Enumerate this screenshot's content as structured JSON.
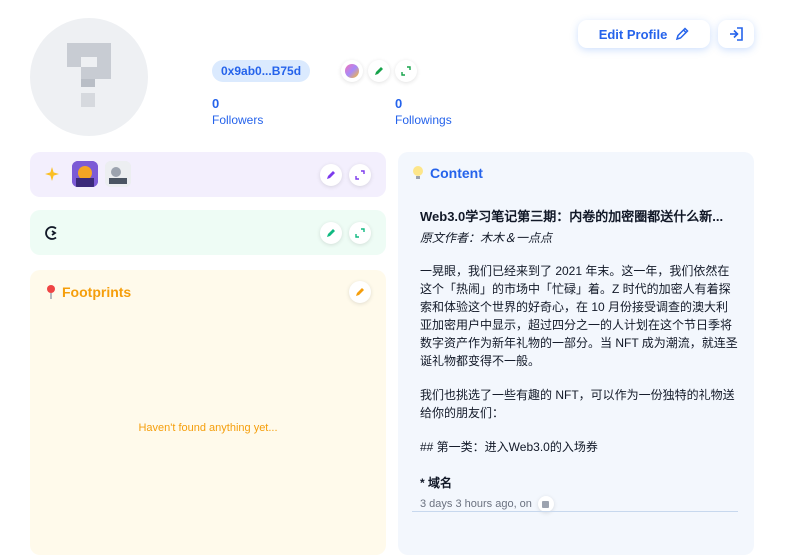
{
  "profile": {
    "address": "0x9ab0...B75d",
    "followers_count": "0",
    "followers_label": "Followers",
    "followings_count": "0",
    "followings_label": "Followings"
  },
  "header": {
    "edit_profile_label": "Edit Profile"
  },
  "footprints": {
    "title": "Footprints",
    "empty_text": "Haven't found anything yet..."
  },
  "content": {
    "title": "Content",
    "post": {
      "title": "Web3.0学习笔记第三期：内卷的加密圈都送什么新...",
      "author": "原文作者：木木＆一点点",
      "para1": "一晃眼，我们已经来到了 2021 年末。这一年，我们依然在这个「热闹」的市场中「忙碌」着。Z 时代的加密人有着探索和体验这个世界的好奇心，在 10 月份接受调查的澳大利亚加密用户中显示，超过四分之一的人计划在这个节日季将数字资产作为新年礼物的一部分。当 NFT 成为潮流，就连圣诞礼物都变得不一般。",
      "para2": "我们也挑选了一些有趣的 NFT，可以作为一份独特的礼物送给你的朋友们：",
      "para3": "## 第一类：进入Web3.0的入场券",
      "subheading": "* 域名",
      "meta": "3 days 3 hours ago, on"
    }
  },
  "colors": {
    "accent": "#2563eb",
    "footprints": "#f59e0b",
    "nft_card_bg": "#f3effd",
    "git_card_bg": "#eefcf5",
    "content_card_bg": "#f3f7fd"
  }
}
